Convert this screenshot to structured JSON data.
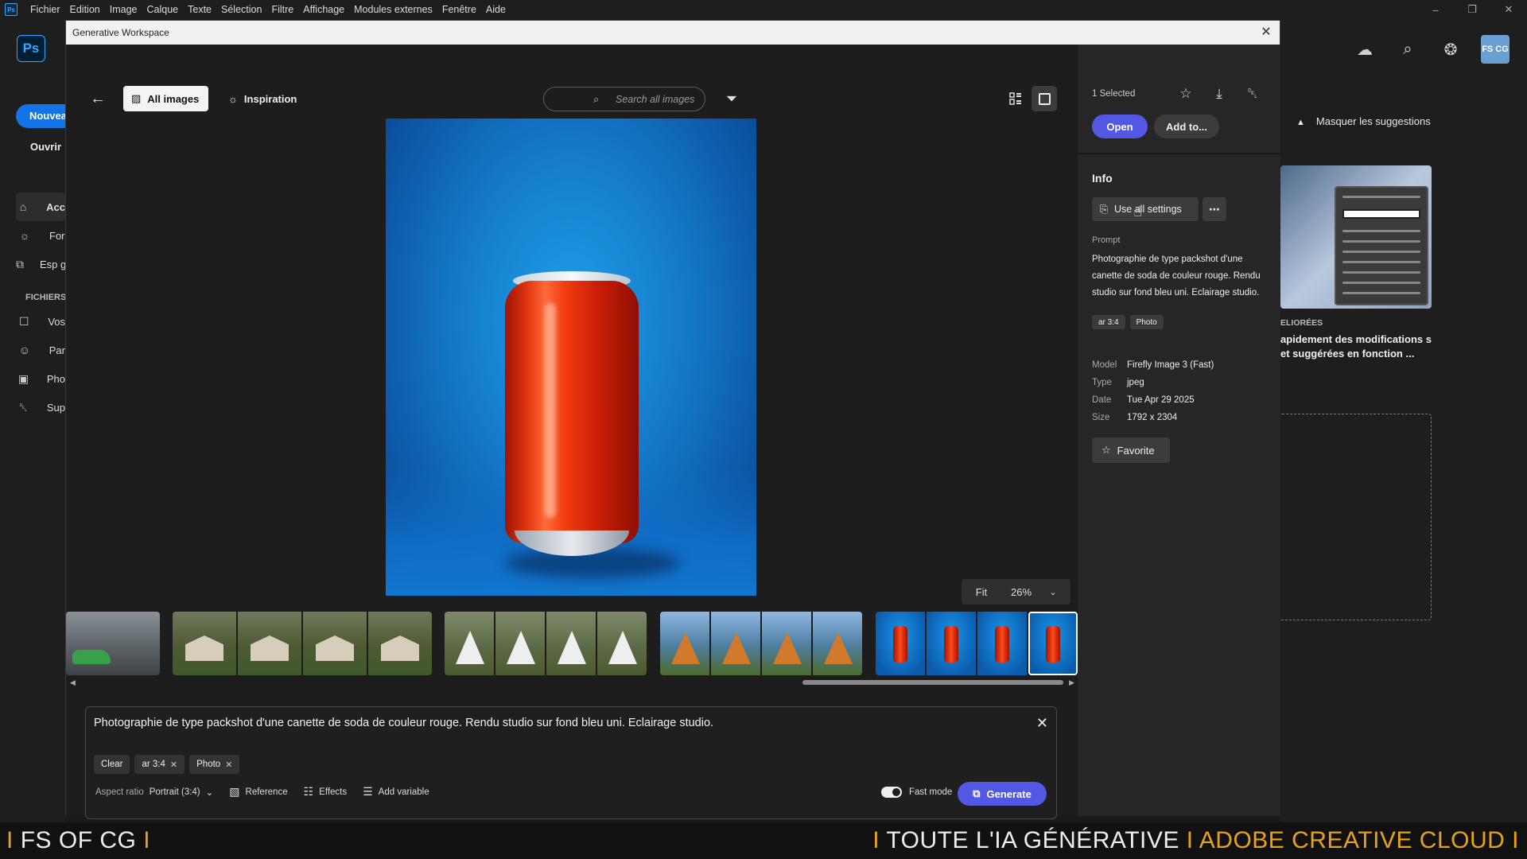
{
  "menubar": {
    "app_icon": "Ps",
    "items": [
      "Fichier",
      "Edition",
      "Image",
      "Calque",
      "Texte",
      "Sélection",
      "Filtre",
      "Affichage",
      "Modules externes",
      "Fenêtre",
      "Aide"
    ]
  },
  "home": {
    "logo": "Ps",
    "new_label": "Nouveau",
    "open_label": "Ouvrir",
    "nav": [
      {
        "icon": "home-icon",
        "label": "Acc"
      },
      {
        "icon": "lightbulb-icon",
        "label": "For"
      },
      {
        "icon": "generative-icon",
        "label": "Esp gén"
      }
    ],
    "files_section": "FICHIERS",
    "files": [
      {
        "icon": "file-icon",
        "label": "Vos"
      },
      {
        "icon": "people-icon",
        "label": "Par"
      },
      {
        "icon": "lightroom-icon",
        "label": "Pho"
      },
      {
        "icon": "trash-icon",
        "label": "Sup"
      }
    ],
    "avatar": "FS CG",
    "hide_suggestions": "Masquer les suggestions",
    "suggestion_tag": "ELIORÉES",
    "suggestion_text": "apidement des modifications s et suggérées en fonction ..."
  },
  "workspace": {
    "title": "Generative Workspace",
    "tabs": {
      "all_images": "All images",
      "inspiration": "Inspiration"
    },
    "search_placeholder": "Search all images",
    "zoom": {
      "fit": "Fit",
      "percent": "26%"
    },
    "prompt": {
      "text": "Photographie de type packshot d'une canette de soda de couleur rouge. Rendu studio sur fond bleu uni. Eclairage studio.",
      "chips": [
        {
          "label": "Clear",
          "removable": false
        },
        {
          "label": "ar 3:4",
          "removable": true
        },
        {
          "label": "Photo",
          "removable": true
        }
      ],
      "aspect_label": "Aspect ratio",
      "aspect_value": "Portrait (3:4)",
      "reference": "Reference",
      "effects": "Effects",
      "add_variable": "Add variable",
      "fast_mode": "Fast mode",
      "generate": "Generate"
    }
  },
  "panel": {
    "selected": "1 Selected",
    "open": "Open",
    "add_to": "Add to...",
    "info": "Info",
    "use_all_settings": "Use all settings",
    "prompt_label": "Prompt",
    "prompt_text": "Photographie de type packshot d'une canette de soda de couleur rouge. Rendu studio sur fond bleu uni. Eclairage studio.",
    "tags": [
      "ar 3:4",
      "Photo"
    ],
    "meta": [
      {
        "key": "Model",
        "value": "Firefly Image 3 (Fast)"
      },
      {
        "key": "Type",
        "value": "jpeg"
      },
      {
        "key": "Date",
        "value": "Tue Apr 29 2025"
      },
      {
        "key": "Size",
        "value": "1792 x 2304"
      }
    ],
    "favorite": "Favorite"
  },
  "banner": {
    "left": "FS OF CG",
    "right_a": "TOUTE L'IA GÉNÉRATIVE",
    "right_b": "ADOBE CREATIVE CLOUD"
  },
  "colors": {
    "accent": "#5258e4",
    "ps_blue": "#31a8ff",
    "banner_orange": "#e8a21a"
  }
}
